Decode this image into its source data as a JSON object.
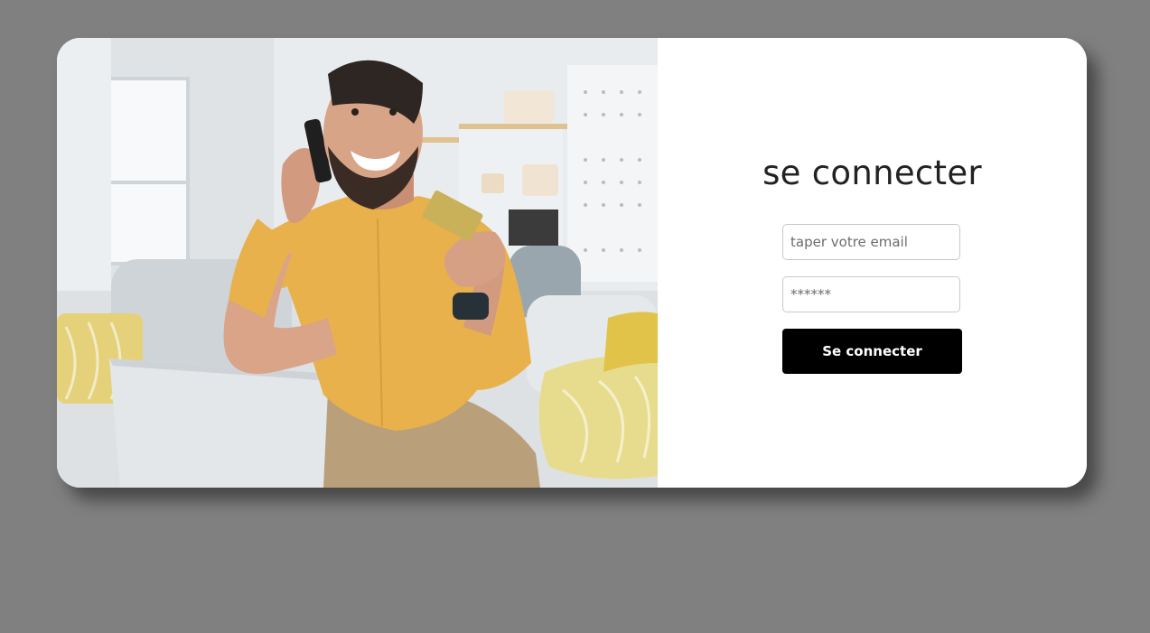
{
  "login": {
    "title": "se connecter",
    "email_placeholder": "taper votre email",
    "password_placeholder": "******",
    "submit_label": "Se connecter"
  },
  "colors": {
    "background": "#808080",
    "card": "#ffffff",
    "button": "#000000",
    "button_text": "#ffffff",
    "title_text": "#222222"
  },
  "hero_image": {
    "subject": "man-on-phone-holding-credit-card"
  }
}
